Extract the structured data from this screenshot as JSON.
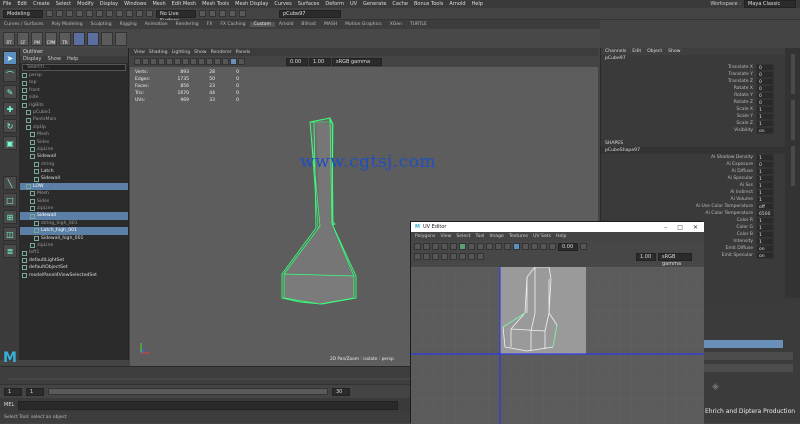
{
  "menubar": {
    "items": [
      "File",
      "Edit",
      "Create",
      "Select",
      "Modify",
      "Display",
      "Windows",
      "Mesh",
      "Edit Mesh",
      "Mesh Tools",
      "Mesh Display",
      "Curves",
      "Surfaces",
      "Deform",
      "UV",
      "Generate",
      "Cache",
      "Bonus Tools",
      "Arnold",
      "Help"
    ],
    "workspace_label": "Workspace :",
    "workspace_value": "Maya Classic"
  },
  "statusline": {
    "mode": "Modeling",
    "live_surface": "No Live Surface",
    "object_name": "pCube97"
  },
  "shelf": {
    "tabs": [
      "Curves / Surfaces",
      "Poly Modeling",
      "Sculpting",
      "Rigging",
      "Animation",
      "Rendering",
      "FX",
      "FX Caching",
      "Custom",
      "Arnold",
      "Bifrost",
      "MASH",
      "Motion Graphics",
      "XGen",
      "TURTLE"
    ],
    "active_tab": "Custom",
    "icons": [
      "RT",
      "CF",
      "PM",
      "CPM",
      "TR"
    ]
  },
  "outliner": {
    "title": "Outliner",
    "menu": [
      "Display",
      "Show",
      "Help"
    ],
    "search_placeholder": "Search...",
    "rows": [
      {
        "label": "persp",
        "state": "dim"
      },
      {
        "label": "top",
        "state": "dim"
      },
      {
        "label": "front",
        "state": "dim"
      },
      {
        "label": "side",
        "state": "dim"
      },
      {
        "label": "rigBits",
        "state": "dim"
      },
      {
        "label": "pCube1",
        "state": "dim"
      },
      {
        "label": "PantsMain",
        "state": "dim"
      },
      {
        "label": "zipUp",
        "state": "dim"
      },
      {
        "label": "Mesh",
        "state": "dim"
      },
      {
        "label": "Sides",
        "state": "dim"
      },
      {
        "label": "zipLine",
        "state": "dim"
      },
      {
        "label": "Sidewall",
        "state": "bright"
      },
      {
        "label": "string",
        "state": "dim"
      },
      {
        "label": "Latch",
        "state": "bright"
      },
      {
        "label": "Sidewall",
        "state": "bright"
      },
      {
        "label": "LOW",
        "state": "sel"
      },
      {
        "label": "Mesh",
        "state": "dim"
      },
      {
        "label": "Sides",
        "state": "dim"
      },
      {
        "label": "zipLine",
        "state": "dim"
      },
      {
        "label": "Sidewall",
        "state": "sel"
      },
      {
        "label": "string_high_001",
        "state": "dim"
      },
      {
        "label": "Latch_high_001",
        "state": "sel"
      },
      {
        "label": "Sidewall_high_001",
        "state": "bright"
      },
      {
        "label": "zipLine",
        "state": "dim"
      },
      {
        "label": "left1",
        "state": "dim"
      },
      {
        "label": "defaultLightSet",
        "state": "bright"
      },
      {
        "label": "defaultObjectSet",
        "state": "bright"
      },
      {
        "label": "modelPanel4ViewSelectedSet",
        "state": "bright"
      }
    ]
  },
  "viewport": {
    "menu": [
      "View",
      "Shading",
      "Lighting",
      "Show",
      "Renderer",
      "Panels"
    ],
    "exposure": "0.00",
    "gamma": "1.00",
    "colorspace": "sRGB gamma",
    "hud": [
      {
        "label": "Verts:",
        "a": "893",
        "b": "28",
        "c": "0"
      },
      {
        "label": "Edges:",
        "a": "1735",
        "b": "50",
        "c": "0"
      },
      {
        "label": "Faces:",
        "a": "856",
        "b": "23",
        "c": "0"
      },
      {
        "label": "Tris:",
        "a": "1670",
        "b": "44",
        "c": "0"
      },
      {
        "label": "UVs:",
        "a": "969",
        "b": "33",
        "c": "0"
      }
    ],
    "camera_label": "2D Pan/Zoom : isolate : persp",
    "watermark": "www.cgtsj.com"
  },
  "channelbox": {
    "tabs": [
      "Channels",
      "Edit",
      "Object",
      "Show"
    ],
    "object": "pCube97",
    "transform": [
      {
        "label": "Translate X",
        "value": "0"
      },
      {
        "label": "Translate Y",
        "value": "0"
      },
      {
        "label": "Translate Z",
        "value": "0"
      },
      {
        "label": "Rotate X",
        "value": "0"
      },
      {
        "label": "Rotate Y",
        "value": "0"
      },
      {
        "label": "Rotate Z",
        "value": "0"
      },
      {
        "label": "Scale X",
        "value": "1"
      },
      {
        "label": "Scale Y",
        "value": "1"
      },
      {
        "label": "Scale Z",
        "value": "1"
      },
      {
        "label": "Visibility",
        "value": "on"
      }
    ],
    "shapes_header": "SHAPES",
    "shape_name": "pCubeShape97",
    "shape_attrs": [
      {
        "label": "Ai Shadow Density",
        "value": "1"
      },
      {
        "label": "Ai Exposure",
        "value": "0"
      },
      {
        "label": "Ai Diffuse",
        "value": "1"
      },
      {
        "label": "Ai Specular",
        "value": "1"
      },
      {
        "label": "Ai Sss",
        "value": "1"
      },
      {
        "label": "Ai Indirect",
        "value": "1"
      },
      {
        "label": "Ai Volume",
        "value": "1"
      },
      {
        "label": "Ai Use Color Temperature",
        "value": "off"
      },
      {
        "label": "Ai Color Temperature",
        "value": "6500"
      },
      {
        "label": "Color R",
        "value": "1"
      },
      {
        "label": "Color G",
        "value": "1"
      },
      {
        "label": "Color B",
        "value": "1"
      },
      {
        "label": "Intensity",
        "value": "1"
      },
      {
        "label": "Emit Diffuse",
        "value": "on"
      },
      {
        "label": "Emit Specular",
        "value": "on"
      }
    ]
  },
  "uveditor": {
    "title": "UV Editor",
    "menu": [
      "Polygons",
      "View",
      "Select",
      "Tool",
      "Image",
      "Textures",
      "UV Sets",
      "Help"
    ],
    "exposure": "0.00",
    "gamma": "1.00",
    "colorspace": "sRGB gamma"
  },
  "rangebar": {
    "start": "1",
    "inner_start": "1",
    "inner_end": "30",
    "end": "30"
  },
  "melbar": {
    "label": "MEL"
  },
  "helpline": {
    "text": "Select Tool: select an object"
  },
  "credit": "Ehrich and Diptera Production",
  "colors": {
    "selected_row": "#5b7fa6",
    "watermark_blue": "#1f4fc0",
    "mesh_wire": "#3aff7a",
    "uv_grid_blue": "#2030ff"
  }
}
